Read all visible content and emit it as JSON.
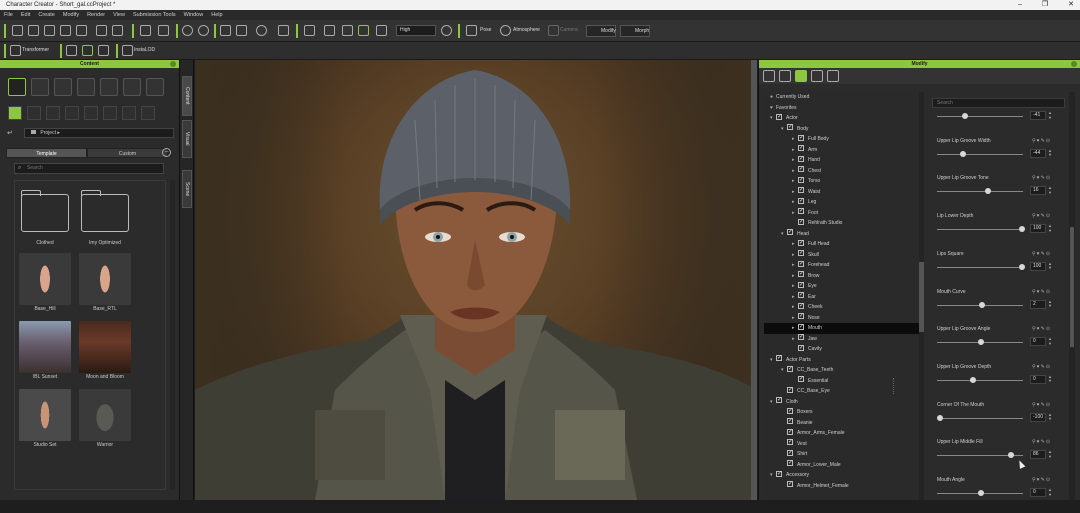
{
  "window": {
    "title": "Character Creator - Short_gal.ccProject *",
    "controls": [
      "–",
      "❐",
      "✕"
    ]
  },
  "menu": [
    "File",
    "Edit",
    "Create",
    "Modify",
    "Render",
    "View",
    "Submission Tools",
    "Window",
    "Help"
  ],
  "toolbar": {
    "quality_dropdown": "High",
    "pose_label": "Pose",
    "atmosphere_label": "Atmosphere",
    "camera_label": "Camera",
    "modify_label": "Modify",
    "morph_label": "Morph"
  },
  "toolbar2": {
    "transformer_label": "Transformer",
    "instalod_label": "InstaLOD"
  },
  "content_panel": {
    "header": "Content",
    "path": "Project",
    "back_icon": "↵",
    "tabs": [
      "Template",
      "Custom"
    ],
    "search_placeholder": "Search",
    "items": [
      {
        "label": "Clothed",
        "kind": "folder"
      },
      {
        "label": "Imy Optimized",
        "kind": "folder"
      },
      {
        "label": "Base_Hill",
        "kind": "figure"
      },
      {
        "label": "Base_RTL",
        "kind": "figure"
      },
      {
        "label": "IBL Sunset",
        "kind": "scene"
      },
      {
        "label": "Moon and Bloom",
        "kind": "scene"
      },
      {
        "label": "Studio Set",
        "kind": "figure"
      },
      {
        "label": "Warrior",
        "kind": "scene"
      }
    ]
  },
  "side_tabs": [
    "Content",
    "Visual",
    "Scene"
  ],
  "modify_panel": {
    "header": "Modify",
    "tree": [
      {
        "label": "Currently Used",
        "level": 0,
        "bullet": true
      },
      {
        "label": "Favorites",
        "level": 0,
        "heart": true
      },
      {
        "label": "Actor",
        "level": 0,
        "expanded": true
      },
      {
        "label": "Body",
        "level": 1,
        "expanded": true
      },
      {
        "label": "Full Body",
        "level": 2
      },
      {
        "label": "Arm",
        "level": 2
      },
      {
        "label": "Hand",
        "level": 2
      },
      {
        "label": "Chest",
        "level": 2
      },
      {
        "label": "Torso",
        "level": 2
      },
      {
        "label": "Waist",
        "level": 2
      },
      {
        "label": "Leg",
        "level": 2
      },
      {
        "label": "Foot",
        "level": 2
      },
      {
        "label": "Rehlrath Studio",
        "level": 2,
        "leaf": true
      },
      {
        "label": "Head",
        "level": 1,
        "expanded": true
      },
      {
        "label": "Full Head",
        "level": 2
      },
      {
        "label": "Skull",
        "level": 2
      },
      {
        "label": "Forehead",
        "level": 2
      },
      {
        "label": "Brow",
        "level": 2
      },
      {
        "label": "Eye",
        "level": 2
      },
      {
        "label": "Ear",
        "level": 2
      },
      {
        "label": "Cheek",
        "level": 2
      },
      {
        "label": "Nose",
        "level": 2
      },
      {
        "label": "Mouth",
        "level": 2,
        "selected": true
      },
      {
        "label": "Jaw",
        "level": 2
      },
      {
        "label": "Cavity",
        "level": 2,
        "leaf": true
      },
      {
        "label": "Actor Parts",
        "level": 0,
        "expanded": true
      },
      {
        "label": "CC_Base_Teeth",
        "level": 1,
        "expanded": true
      },
      {
        "label": "Essential",
        "level": 2,
        "leaf": true
      },
      {
        "label": "CC_Base_Eye",
        "level": 1,
        "leaf": true
      },
      {
        "label": "Cloth",
        "level": 0,
        "expanded": true
      },
      {
        "label": "Boxers",
        "level": 1,
        "leaf": true
      },
      {
        "label": "Beanie",
        "level": 1,
        "leaf": true
      },
      {
        "label": "Armor_Arms_Female",
        "level": 1,
        "leaf": true
      },
      {
        "label": "Vest",
        "level": 1,
        "leaf": true
      },
      {
        "label": "Shirt",
        "level": 1,
        "leaf": true
      },
      {
        "label": "Armor_Lower_Male",
        "level": 1,
        "leaf": true
      },
      {
        "label": "Accessory",
        "level": 0,
        "expanded": true
      },
      {
        "label": "Armor_Helmet_Female",
        "level": 1,
        "leaf": true
      }
    ],
    "search_placeholder": "Search",
    "sliders": [
      {
        "label": "",
        "value": "-41",
        "pos": 0.3
      },
      {
        "label": "Upper Lip Groove Width",
        "value": "-44",
        "pos": 0.28
      },
      {
        "label": "Upper Lip Groove Tone",
        "value": "16",
        "pos": 0.58
      },
      {
        "label": "Lip Lower Depth",
        "value": "100",
        "pos": 1.0
      },
      {
        "label": "Lips Square",
        "value": "100",
        "pos": 1.0
      },
      {
        "label": "Mouth Curve",
        "value": "2",
        "pos": 0.51
      },
      {
        "label": "Upper Lip Groove Angle",
        "value": "0",
        "pos": 0.5
      },
      {
        "label": "Upper Lip Groove Depth",
        "value": "0",
        "pos": 0.4
      },
      {
        "label": "Corner Of The Mouth",
        "value": "-100",
        "pos": 0.0
      },
      {
        "label": "Upper Lip Middle Fill",
        "value": "86",
        "pos": 0.86
      },
      {
        "label": "Mouth Angle",
        "value": "0",
        "pos": 0.5
      }
    ]
  },
  "colors": {
    "accent": "#8dc63f",
    "panel": "#2b2b2b",
    "selected_row": "#0c0c0c"
  }
}
